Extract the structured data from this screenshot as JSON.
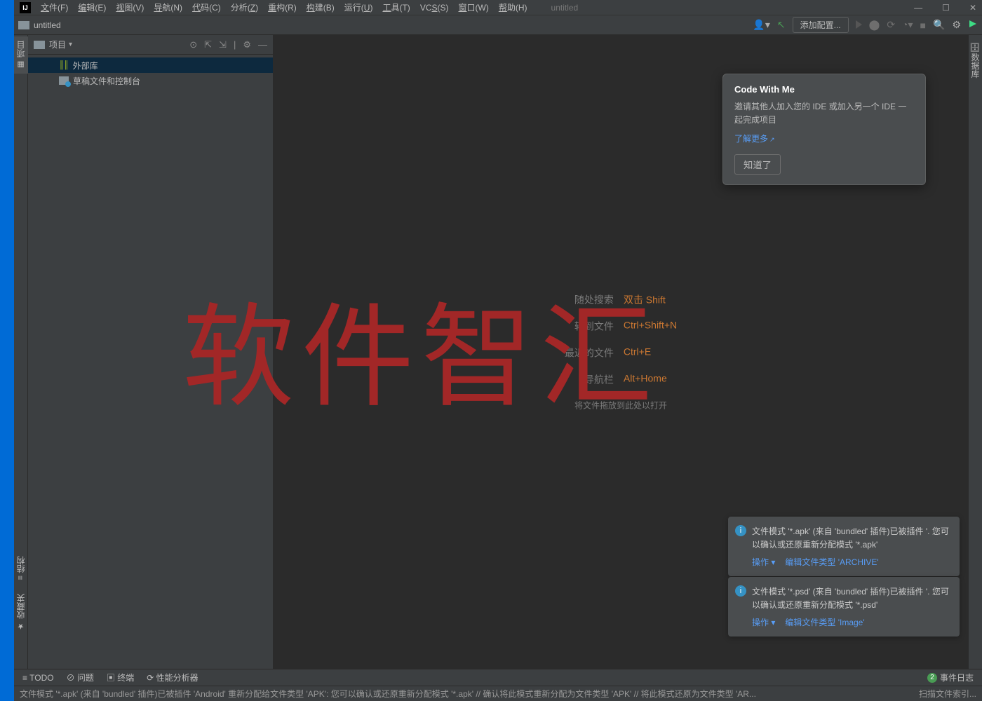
{
  "menubar": {
    "logo": "IJ",
    "items": [
      {
        "pre": "",
        "u": "文",
        "post": "件(F)"
      },
      {
        "pre": "",
        "u": "编",
        "post": "辑(E)"
      },
      {
        "pre": "",
        "u": "视",
        "post": "图(V)"
      },
      {
        "pre": "",
        "u": "导",
        "post": "航(N)"
      },
      {
        "pre": "",
        "u": "代",
        "post": "码(C)"
      },
      {
        "pre": "分析(",
        "u": "Z",
        "post": ")"
      },
      {
        "pre": "",
        "u": "重",
        "post": "构(R)"
      },
      {
        "pre": "",
        "u": "构",
        "post": "建(B)"
      },
      {
        "pre": "运行(",
        "u": "U",
        "post": ")"
      },
      {
        "pre": "",
        "u": "工",
        "post": "具(T)"
      },
      {
        "pre": "VC",
        "u": "S",
        "post": "(S)"
      },
      {
        "pre": "",
        "u": "窗",
        "post": "口(W)"
      },
      {
        "pre": "",
        "u": "帮",
        "post": "助(H)"
      }
    ],
    "title": "untitled",
    "win": {
      "min": "—",
      "max": "☐",
      "close": "✕"
    }
  },
  "navbar": {
    "crumb": "untitled",
    "config": "添加配置...",
    "icons": {
      "user": "👤▾",
      "hammer": "↖",
      "run": "▶",
      "bug": "⬤",
      "cover": "⟳",
      "profile": "◔▾",
      "stop": "■",
      "search": "🔍",
      "gear": "⚙",
      "ide": "▶"
    }
  },
  "sidebar": {
    "tabs": {
      "project": "项目",
      "structure": "结构",
      "favorites": "收藏夹"
    },
    "header": {
      "label": "项目",
      "tools": {
        "target": "⊙",
        "expand": "⇱",
        "collapse": "⇲",
        "divider": "|",
        "gear": "⚙",
        "hide": "—"
      }
    },
    "tree": {
      "item1": {
        "label": "外部库"
      },
      "item2": {
        "label": "草稿文件和控制台"
      }
    }
  },
  "right_gutter": {
    "db": "数据库"
  },
  "editor": {
    "hints": [
      {
        "label": "随处搜索",
        "key": "双击 Shift"
      },
      {
        "label": "转到文件",
        "key": "Ctrl+Shift+N"
      },
      {
        "label": "最近的文件",
        "key": "Ctrl+E"
      },
      {
        "label": "导航栏",
        "key": "Alt+Home"
      }
    ],
    "drop": "将文件拖放到此处以打开"
  },
  "popup": {
    "title": "Code With Me",
    "desc": "邀请其他人加入您的 IDE 或加入另一个 IDE 一起完成项目",
    "link": "了解更多",
    "ext": "↗",
    "button": "知道了"
  },
  "notifications": [
    {
      "icon": "i",
      "text": "文件模式 '*.apk' (来自 'bundled' 插件)已被插件 '. 您可以确认或还原重新分配模式 '*.apk'",
      "action1": "操作 ▾",
      "action2": "编辑文件类型 'ARCHIVE'"
    },
    {
      "icon": "i",
      "text": "文件模式 '*.psd' (来自 'bundled' 插件)已被插件 '. 您可以确认或还原重新分配模式 '*.psd'",
      "action1": "操作 ▾",
      "action2": "编辑文件类型 'Image'"
    }
  ],
  "bottombar": {
    "todo": "≡ TODO",
    "problems": "⊘ 问题",
    "terminal": "▣ 终端",
    "profiler": "⟳ 性能分析器",
    "events_count": "2",
    "events": "事件日志"
  },
  "statusbar": {
    "msg": "文件模式 '*.apk' (来自 'bundled' 插件)已被插件 'Android' 重新分配给文件类型 'APK': 您可以确认或还原重新分配模式 '*.apk' // 确认将此模式重新分配为文件类型 'APK' // 将此模式还原为文件类型 'AR...",
    "index": "扫描文件索引..."
  },
  "watermark": "软件智汇"
}
